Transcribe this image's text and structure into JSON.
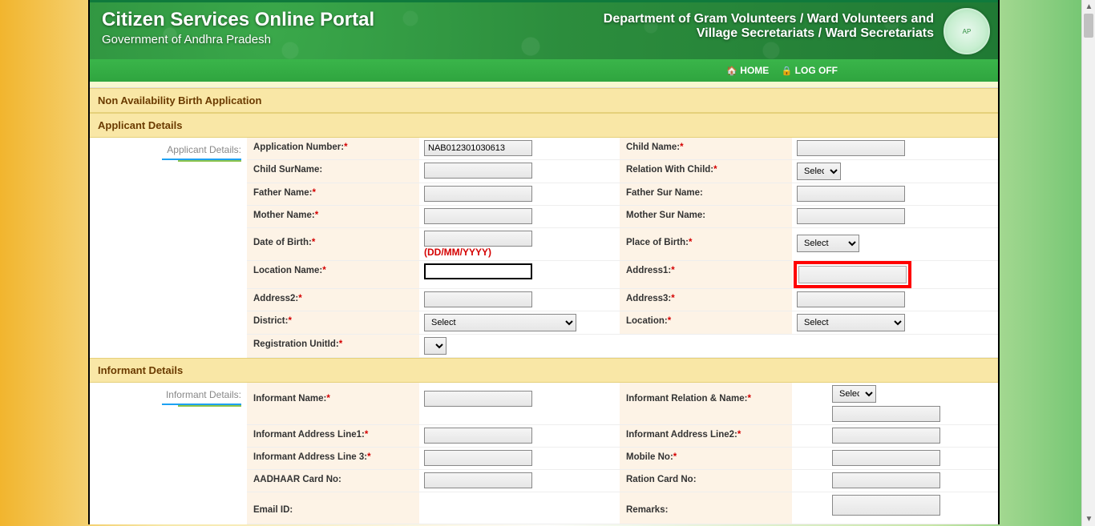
{
  "banner": {
    "title": "Citizen Services Online Portal",
    "subtitle": "Government of Andhra Pradesh",
    "dept_line1": "Department of Gram Volunteers / Ward Volunteers and",
    "dept_line2": "Village Secretariats / Ward Secretariats"
  },
  "nav": {
    "home": "HOME",
    "logoff": "LOG OFF"
  },
  "sections": {
    "app_title": "Non Availability Birth Application",
    "applicant": "Applicant Details",
    "informant": "Informant Details"
  },
  "side": {
    "applicant": "Applicant Details:",
    "informant": "Informant Details:"
  },
  "labels": {
    "app_no": "Application Number:",
    "child_name": "Child Name:",
    "child_surname": "Child SurName:",
    "relation": "Relation With Child:",
    "father_name": "Father Name:",
    "father_surname": "Father Sur Name:",
    "mother_name": "Mother Name:",
    "mother_surname": "Mother Sur Name:",
    "dob": "Date of Birth:",
    "dob_hint": "(DD/MM/YYYY)",
    "pob": "Place of Birth:",
    "loc_name": "Location Name:",
    "addr1": "Address1:",
    "addr2": "Address2:",
    "addr3": "Address3:",
    "district": "District:",
    "location": "Location:",
    "reg_unit": "Registration UnitId:",
    "inf_name": "Informant Name:",
    "inf_rel": "Informant Relation & Name:",
    "inf_addr1": "Informant Address Line1:",
    "inf_addr2": "Informant Address Line2:",
    "inf_addr3": "Informant Address Line 3:",
    "mobile": "Mobile No:",
    "aadhaar": "AADHAAR Card No:",
    "ration": "Ration Card No:",
    "email": "Email ID:",
    "remarks": "Remarks:"
  },
  "values": {
    "app_no": "NAB012301030613"
  },
  "selects": {
    "select_opt": "Select"
  }
}
